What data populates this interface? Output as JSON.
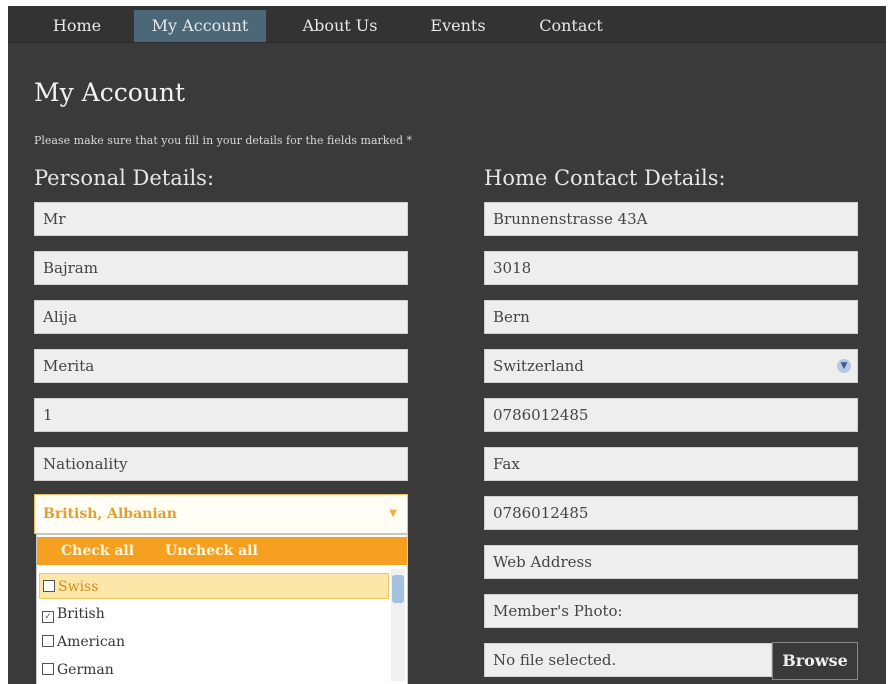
{
  "nav": {
    "home": "Home",
    "my_account": "My Account",
    "about_us": "About Us",
    "events": "Events",
    "contact": "Contact"
  },
  "page": {
    "title": "My Account",
    "note": "Please make sure that you fill in your details for the fields marked *"
  },
  "personal": {
    "heading": "Personal Details:",
    "title_value": "Mr",
    "first_name": "Bajram",
    "last_name": "Alija",
    "middle_name": "Merita",
    "number": "1",
    "nationality_placeholder": "Nationality",
    "nationality_selected": "British, Albanian",
    "nationality_dropdown": {
      "check_all": "Check all",
      "uncheck_all": "Uncheck all",
      "options": [
        {
          "label": "Swiss",
          "checked": false
        },
        {
          "label": "British",
          "checked": true
        },
        {
          "label": "American",
          "checked": false
        },
        {
          "label": "German",
          "checked": false
        }
      ]
    }
  },
  "contact": {
    "heading": "Home Contact Details:",
    "street": "Brunnenstrasse 43A",
    "postcode": "3018",
    "city": "Bern",
    "country": "Switzerland",
    "phone": "0786012485",
    "fax_placeholder": "Fax",
    "mobile": "0786012485",
    "web_placeholder": "Web Address",
    "photo_label": "Member's Photo:",
    "file_status": "No file selected.",
    "browse_label": "Browse"
  },
  "colors": {
    "background": "#3a3a3a",
    "active_nav": "#4a6878",
    "dropdown_header": "#f5a020"
  }
}
